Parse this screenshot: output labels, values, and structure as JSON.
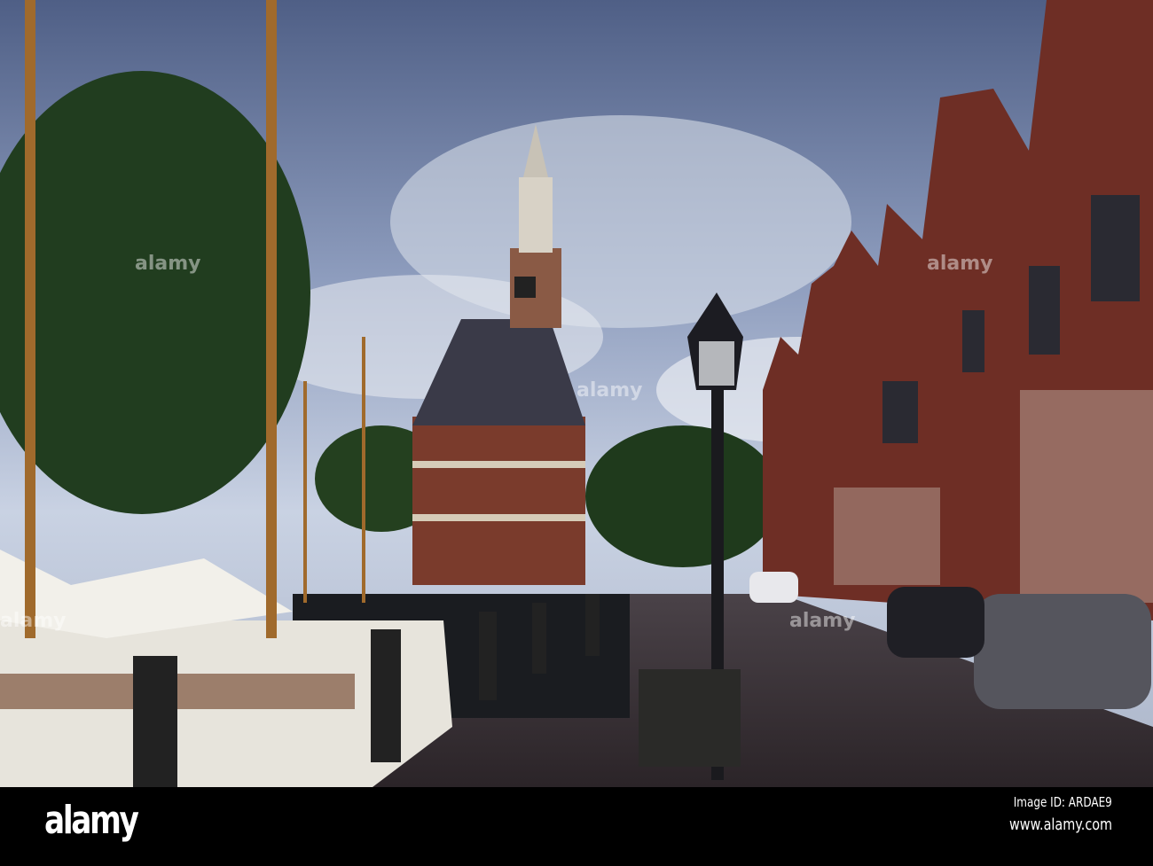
{
  "photo": {
    "colors": {
      "sky": "#7d8fb3",
      "brick": "#6e2e25",
      "tree": "#1f3a1c",
      "street": "#3a3033"
    }
  },
  "watermark": {
    "text": "alamy"
  },
  "footer": {
    "logo": "alamy",
    "image_id": "Image ID: ARDAE9",
    "url": "www.alamy.com"
  }
}
